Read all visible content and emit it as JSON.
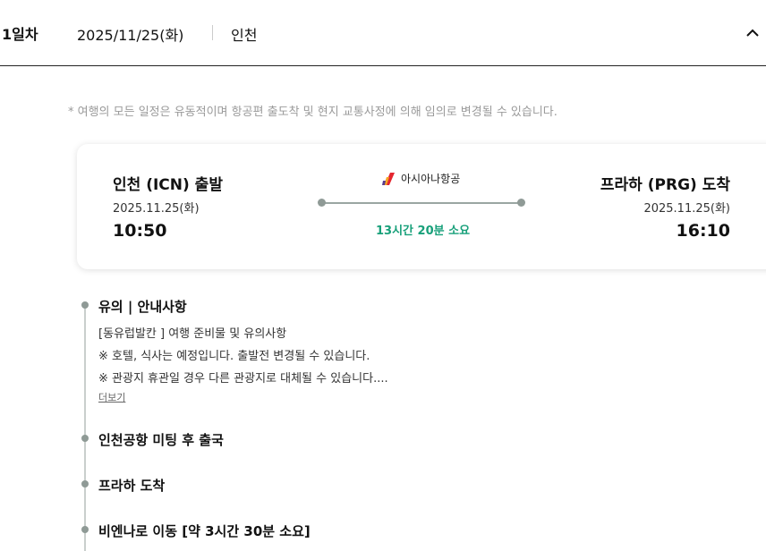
{
  "day": {
    "label": "1일차",
    "date": "2025/11/25(화)",
    "city": "인천",
    "collapse_icon": "chevron-up-icon"
  },
  "notice": "* 여행의 모든 일정은 유동적이며 항공편 출도착 및 현지 교통사정에 의해 임의로 변경될 수 있습니다.",
  "flight": {
    "departure": {
      "title": "인천 (ICN) 출발",
      "date": "2025.11.25(화)",
      "time": "10:50"
    },
    "arrival": {
      "title": "프라하 (PRG) 도착",
      "date": "2025.11.25(화)",
      "time": "16:10"
    },
    "airline": {
      "name": "아시아나항공",
      "logo_icon": "asiana-logo-icon"
    },
    "duration": "13시간 20분 소요",
    "accent_color": "#18a07a"
  },
  "timeline": {
    "notice_item": {
      "title": "유의  |  안내사항",
      "lines": [
        "[동유럽발칸 ] 여행 준비물 및 유의사항",
        "※ 호텔, 식사는 예정입니다. 출발전 변경될 수 있습니다.",
        "※ 관광지 휴관일 경우 다른 관광지로 대체될 수 있습니다...."
      ],
      "more_label": "더보기"
    },
    "items": [
      {
        "title": "인천공항 미팅 후 출국"
      },
      {
        "title": "프라하 도착"
      },
      {
        "title": "비엔나로 이동 [약 3시간 30분 소요]"
      }
    ]
  }
}
